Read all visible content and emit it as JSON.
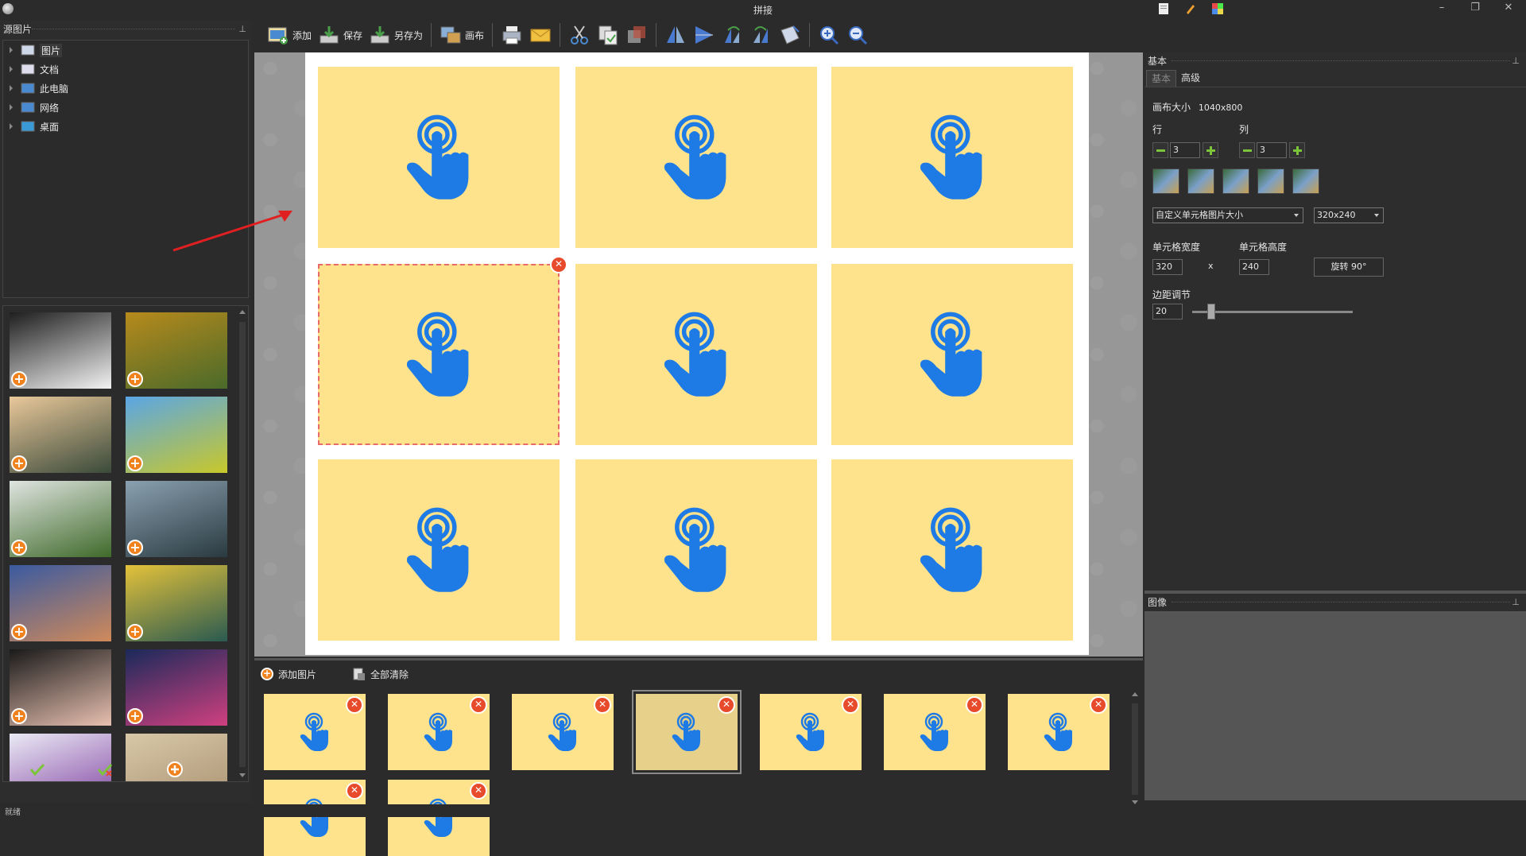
{
  "window": {
    "title": "拼接"
  },
  "left_panel": {
    "header": "源图片",
    "tree": [
      {
        "label": "图片",
        "icon": "picture-folder-icon"
      },
      {
        "label": "文档",
        "icon": "document-folder-icon"
      },
      {
        "label": "此电脑",
        "icon": "computer-icon"
      },
      {
        "label": "网络",
        "icon": "network-icon"
      },
      {
        "label": "桌面",
        "icon": "desktop-icon"
      }
    ],
    "thumbnails": [
      {
        "name": "screenshot-ui",
        "colors": [
          "#1e1e1e",
          "#f3f3f3"
        ]
      },
      {
        "name": "autumn-forest-road",
        "colors": [
          "#b78a1c",
          "#4a6a2a"
        ]
      },
      {
        "name": "misty-temple",
        "colors": [
          "#e9c89a",
          "#3a4a3a"
        ]
      },
      {
        "name": "green-tree-field",
        "colors": [
          "#5aa6e6",
          "#c8c82a"
        ]
      },
      {
        "name": "misty-hills-forest",
        "colors": [
          "#dfe4e0",
          "#3f6a2a"
        ]
      },
      {
        "name": "river-boat-mountains",
        "colors": [
          "#8aa0b0",
          "#2a3a40"
        ]
      },
      {
        "name": "bridge-dusk",
        "colors": [
          "#3a5aa0",
          "#d08a5a"
        ]
      },
      {
        "name": "yellow-houses",
        "colors": [
          "#e4c23a",
          "#2a5a50"
        ]
      },
      {
        "name": "portrait-girl",
        "colors": [
          "#1a1a1a",
          "#e8c0b0"
        ]
      },
      {
        "name": "app-collage",
        "colors": [
          "#1a2a5a",
          "#d04080"
        ]
      },
      {
        "name": "screenshot-editor",
        "colors": [
          "#eaeaf5",
          "#8040a0"
        ]
      },
      {
        "name": "desert-dunes",
        "colors": [
          "#d8c8a8",
          "#a89070"
        ]
      }
    ]
  },
  "toolbar": {
    "add": "添加",
    "save": "保存",
    "save_as": "另存为",
    "canvas": "画布"
  },
  "bottom_strip": {
    "add_images": "添加图片",
    "clear_all": "全部清除"
  },
  "right_panel": {
    "header": "基本",
    "tabs": [
      "基本",
      "高级"
    ],
    "canvas_size_label": "画布大小",
    "canvas_size_value": "1040x800",
    "rows_label": "行",
    "cols_label": "列",
    "rows_value": "3",
    "cols_value": "3",
    "cell_size_mode": "自定义单元格图片大小",
    "cell_size_preset": "320x240",
    "cell_width_label": "单元格宽度",
    "cell_height_label": "单元格高度",
    "cell_width_value": "320",
    "x_sep": "x",
    "cell_height_value": "240",
    "rotate_label": "旋转 90°",
    "margin_label": "边距调节",
    "margin_value": "20",
    "margin_slider_value": 0.1,
    "image_header": "图像"
  },
  "status": {
    "left": "就绪"
  },
  "colors": {
    "cell": "#ffe38c",
    "hand": "#1e7be6",
    "close": "#e84a2c",
    "plus": "#f0821e",
    "accent_green": "#7cc43a"
  }
}
